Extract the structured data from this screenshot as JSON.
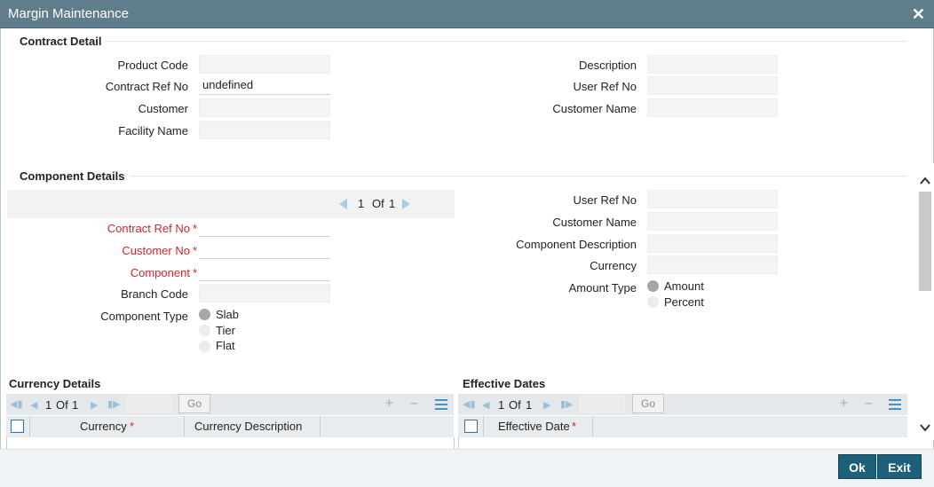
{
  "window": {
    "title": "Margin Maintenance"
  },
  "contract_detail": {
    "title": "Contract Detail",
    "product_code_label": "Product Code",
    "product_code_value": "",
    "contract_ref_label": "Contract Ref No",
    "contract_ref_value": "undefined",
    "customer_label": "Customer",
    "customer_value": "",
    "facility_label": "Facility Name",
    "facility_value": "",
    "description_label": "Description",
    "description_value": "",
    "user_ref_label": "User Ref No",
    "user_ref_value": "",
    "customer_name_label": "Customer Name",
    "customer_name_value": ""
  },
  "component_details": {
    "title": "Component Details",
    "pager": {
      "current": "1",
      "of_label": "Of",
      "total": "1"
    },
    "contract_ref_label": "Contract Ref No",
    "customer_no_label": "Customer No",
    "component_label": "Component",
    "required_mark": "*",
    "branch_code_label": "Branch Code",
    "component_type_label": "Component Type",
    "component_type_options": [
      "Slab",
      "Tier",
      "Flat"
    ],
    "component_type_selected": "Slab",
    "user_ref_label": "User Ref No",
    "customer_name_label": "Customer Name",
    "component_desc_label": "Component Description",
    "currency_label": "Currency",
    "amount_type_label": "Amount Type",
    "amount_type_options": [
      "Amount",
      "Percent"
    ],
    "amount_type_selected": "Amount"
  },
  "currency_details": {
    "title": "Currency Details",
    "pager": {
      "current": "1",
      "of_label": "Of",
      "total": "1"
    },
    "go_label": "Go",
    "columns": [
      "Currency",
      "Currency Description"
    ],
    "required_col": "Currency",
    "rows": []
  },
  "effective_dates": {
    "title": "Effective Dates",
    "pager": {
      "current": "1",
      "of_label": "Of",
      "total": "1"
    },
    "go_label": "Go",
    "columns": [
      "Effective Date"
    ],
    "rows": []
  },
  "footer": {
    "ok_label": "Ok",
    "exit_label": "Exit"
  },
  "colors": {
    "titlebar": "#607d8b",
    "button": "#1e5f7a",
    "required": "#d0272b"
  }
}
